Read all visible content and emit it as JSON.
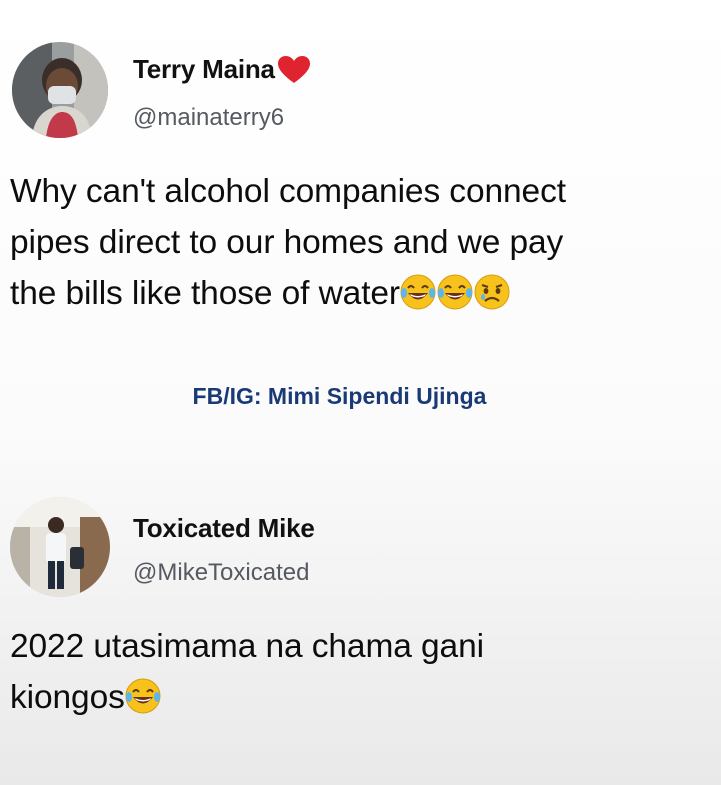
{
  "tweets": [
    {
      "display_name": "Terry Maina",
      "handle": "@mainaterry6",
      "text_lines": [
        "Why can't alcohol companies connect",
        "pipes direct to our homes and we pay",
        "the bills like those of water"
      ],
      "name_emoji": "heart-icon",
      "trailing_emojis": [
        "laughing-tears-emoji",
        "laughing-tears-emoji",
        "worried-face-emoji"
      ]
    },
    {
      "display_name": "Toxicated Mike",
      "handle": "@MikeToxicated",
      "text_lines": [
        "2022 utasimama na chama gani",
        "kiongos"
      ],
      "trailing_emojis": [
        "laughing-tears-emoji"
      ]
    }
  ],
  "watermark": "FB/IG: Mimi Sipendi Ujinga",
  "colors": {
    "heart": "#e0242f",
    "handle": "#555a60",
    "watermark": "#1a3a75",
    "emoji_face": "#f7c21c"
  }
}
